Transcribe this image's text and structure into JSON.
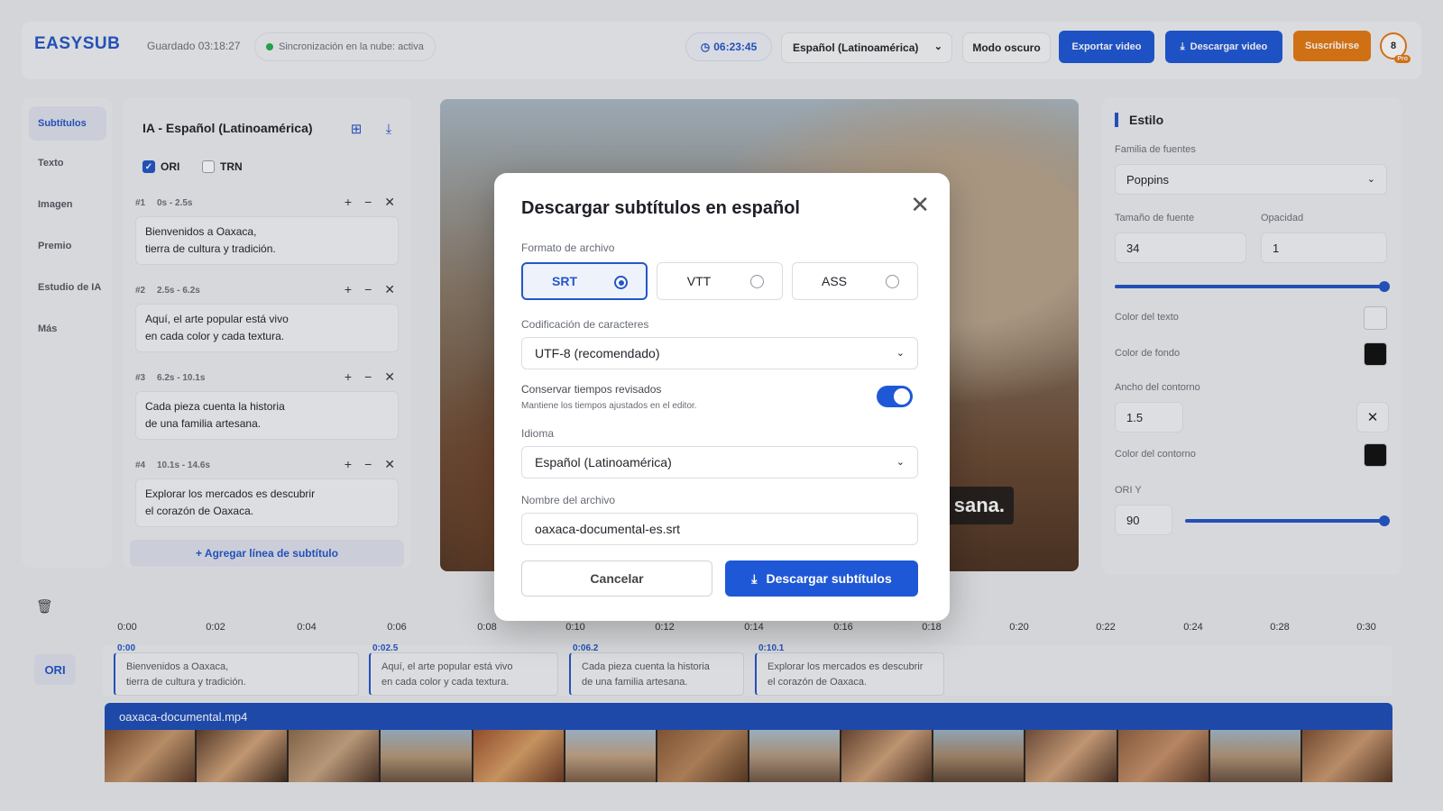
{
  "header": {
    "logo": "EASYSUB",
    "saved": "Guardado 03:18:27",
    "sync": "Sincronización en la nube: activa",
    "timer": "06:23:45",
    "language": "Español (Latinoamérica)",
    "dark_mode": "Modo oscuro",
    "export": "Exportar video",
    "download": "Descargar video",
    "subscribe": "Suscribirse",
    "avatar": "8",
    "badge": "Pro"
  },
  "nav": [
    "Subtítulos",
    "Texto",
    "Imagen",
    "Premio",
    "Estudio de IA",
    "Más"
  ],
  "subtitles": {
    "title": "IA - Español (Latinoamérica)",
    "ori": "ORI",
    "trn": "TRN",
    "entries": [
      {
        "num": "#1",
        "time": "0s - 2.5s",
        "text": "Bienvenidos a Oaxaca,\ntierra de cultura y tradición."
      },
      {
        "num": "#2",
        "time": "2.5s - 6.2s",
        "text": "Aquí, el arte popular está vivo\nen cada color y cada textura."
      },
      {
        "num": "#3",
        "time": "6.2s - 10.1s",
        "text": "Cada pieza cuenta la historia\nde una familia artesana."
      },
      {
        "num": "#4",
        "time": "10.1s - 14.6s",
        "text": "Explorar los mercados es descubrir\nel corazón de Oaxaca."
      }
    ],
    "add": "+ Agregar línea de subtítulo"
  },
  "video": {
    "caption": "sana."
  },
  "style": {
    "title": "Estilo",
    "font_family_label": "Familia de fuentes",
    "font_family": "Poppins",
    "font_size_label": "Tamaño de fuente",
    "font_size": "34",
    "opacity_label": "Opacidad",
    "opacity": "1",
    "text_color_label": "Color del texto",
    "bg_color_label": "Color de fondo",
    "outline_width_label": "Ancho del contorno",
    "outline_width": "1.5",
    "outline_color_label": "Color del contorno",
    "ori_y_label": "ORI Y",
    "ori_y": "90",
    "colors": {
      "text": "#f3f4f6",
      "background": "#111111",
      "outline": "#111111"
    }
  },
  "timeline": {
    "ticks": [
      "0:00",
      "0:02",
      "0:04",
      "0:06",
      "0:08",
      "0:10",
      "0:12",
      "0:14",
      "0:16",
      "0:18",
      "0:20",
      "0:22",
      "0:24",
      "0:28",
      "0:30"
    ],
    "track": "ORI",
    "clips": [
      {
        "time": "0:00",
        "text": "Bienvenidos a Oaxaca,\ntierra de cultura y tradición."
      },
      {
        "time": "0:02.5",
        "text": "Aquí, el arte popular está vivo\nen cada color y cada textura."
      },
      {
        "time": "0:06.2",
        "text": "Cada pieza cuenta la historia\nde una familia artesana."
      },
      {
        "time": "0:10.1",
        "text": "Explorar los mercados es descubrir\nel corazón de Oaxaca."
      }
    ],
    "file": "oaxaca-documental.mp4"
  },
  "modal": {
    "title": "Descargar subtítulos en español",
    "format_label": "Formato de archivo",
    "formats": [
      "SRT",
      "VTT",
      "ASS"
    ],
    "selected_format": "SRT",
    "encoding_label": "Codificación de caracteres",
    "encoding": "UTF-8 (recomendado)",
    "keep_title": "Conservar tiempos revisados",
    "keep_desc": "Mantiene los tiempos ajustados en el editor.",
    "keep_enabled": true,
    "language_label": "Idioma",
    "language": "Español (Latinoamérica)",
    "filename_label": "Nombre del archivo",
    "filename": "oaxaca-documental-es.srt",
    "cancel": "Cancelar",
    "download": "Descargar subtítulos"
  },
  "accent": "#1f58d6",
  "orange": "#e57a12"
}
